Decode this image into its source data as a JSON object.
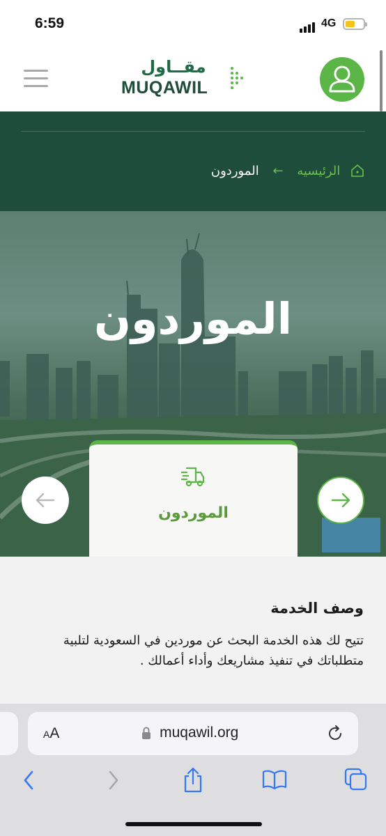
{
  "status_bar": {
    "time": "6:59",
    "network": "4G"
  },
  "header": {
    "logo_arabic": "مقــاول",
    "logo_english": "MUQAWIL",
    "colors": {
      "brand_green": "#5bb547",
      "brand_dark": "#1e4d3a"
    }
  },
  "breadcrumb": {
    "home": "الرئيسيه",
    "current": "الموردون"
  },
  "hero": {
    "title": "الموردون"
  },
  "service_card": {
    "label": "الموردون",
    "icon": "truck-icon"
  },
  "description": {
    "title": "وصف الخدمة",
    "body": "تتيح لك هذه الخدمة البحث عن موردين في السعودية لتلبية متطلباتك في تنفيذ مشاريعك وأداء أعمالك ."
  },
  "browser": {
    "text_size_label_small": "A",
    "text_size_label_large": "A",
    "url": "muqawil.org"
  }
}
